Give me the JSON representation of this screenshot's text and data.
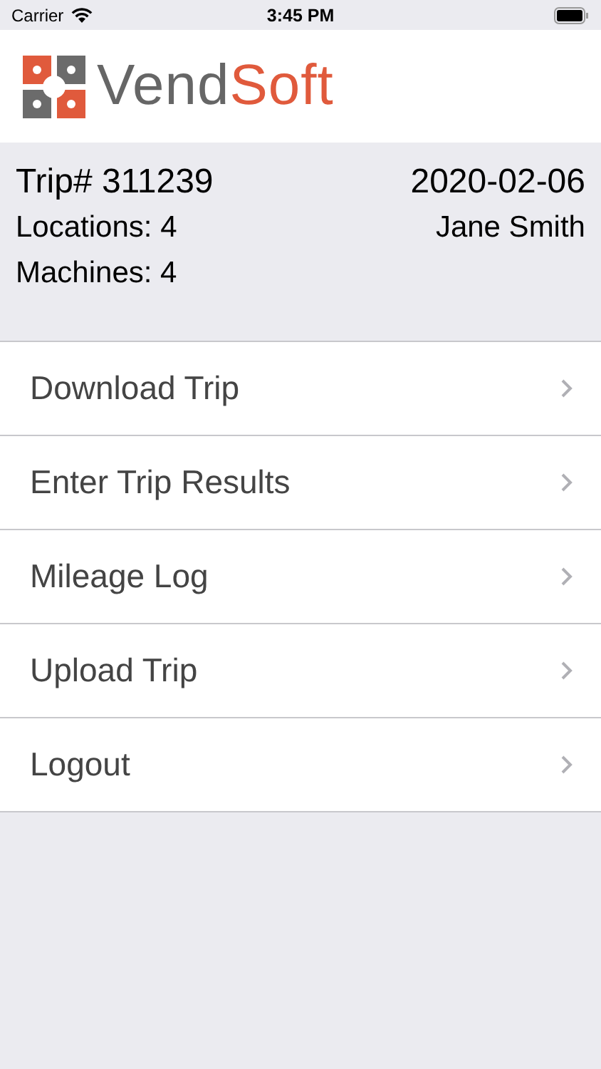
{
  "status_bar": {
    "carrier": "Carrier",
    "time": "3:45 PM"
  },
  "logo": {
    "first": "Vend",
    "second": "Soft"
  },
  "trip": {
    "number": "Trip# 311239",
    "date": "2020-02-06",
    "locations": "Locations: 4",
    "driver": "Jane Smith",
    "machines": "Machines: 4"
  },
  "menu": [
    {
      "label": "Download Trip"
    },
    {
      "label": "Enter Trip Results"
    },
    {
      "label": "Mileage Log"
    },
    {
      "label": "Upload Trip"
    },
    {
      "label": "Logout"
    }
  ]
}
